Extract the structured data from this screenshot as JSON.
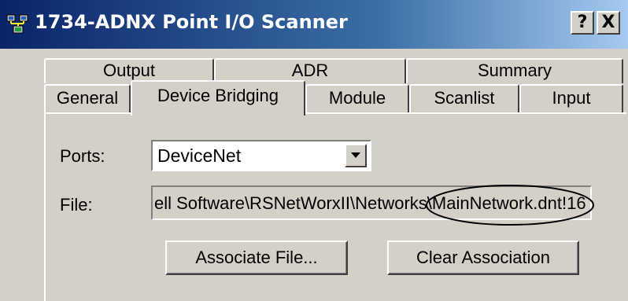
{
  "window": {
    "title": "1734-ADNX Point I/O Scanner",
    "help_label": "?",
    "close_label": "X"
  },
  "tabs": {
    "row_back": [
      "Output",
      "ADR",
      "Summary"
    ],
    "row_front": [
      "General",
      "Device Bridging",
      "Module",
      "Scanlist",
      "Input"
    ],
    "active": "Device Bridging"
  },
  "form": {
    "ports_label": "Ports:",
    "ports_value": "DeviceNet",
    "file_label": "File:",
    "file_value": "ell Software\\RSNetWorxII\\Networks\\MainNetwork.dnt!16"
  },
  "buttons": {
    "associate": "Associate File...",
    "clear": "Clear Association"
  },
  "annotation": {
    "highlight_color": "#000000"
  }
}
